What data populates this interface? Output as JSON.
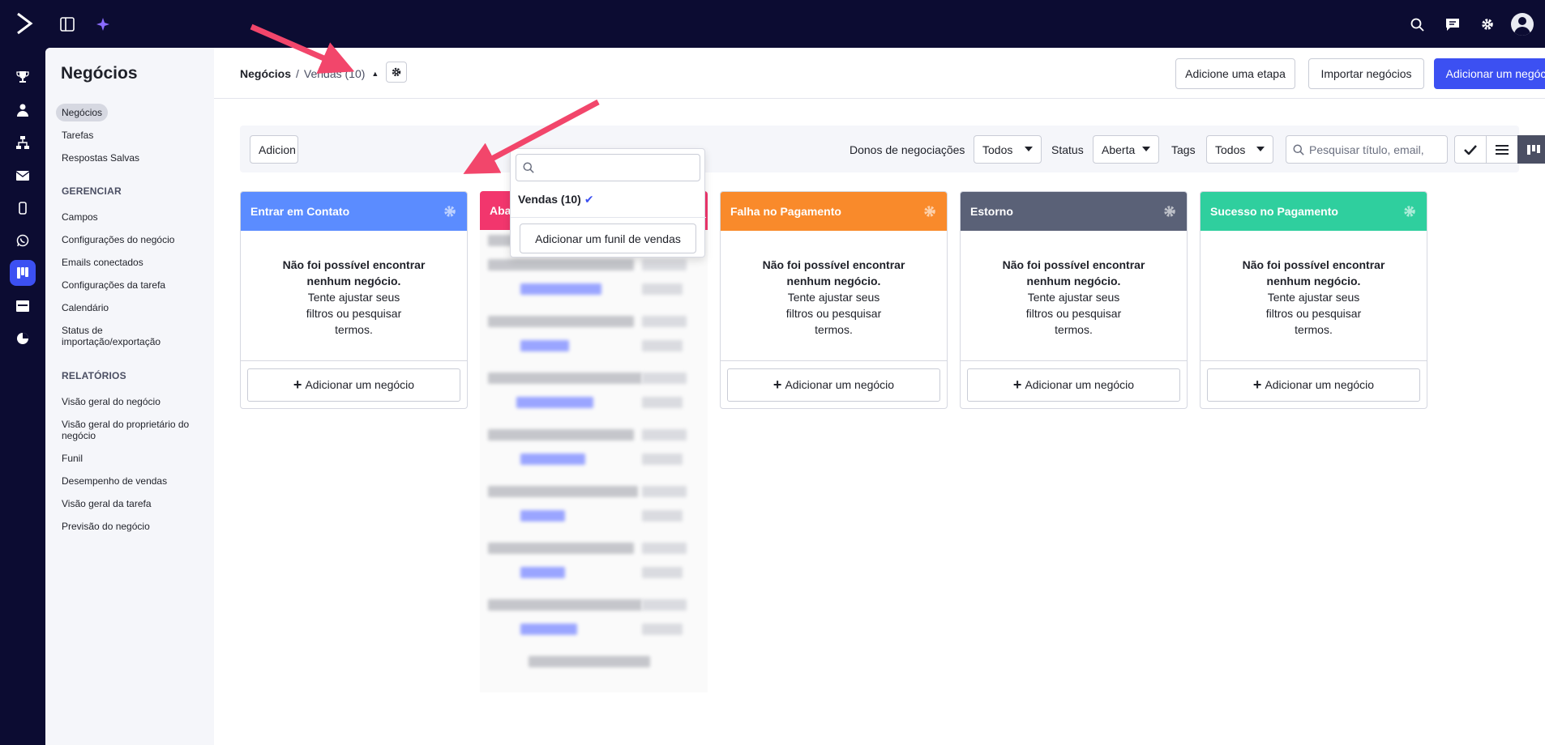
{
  "colors": {
    "brand_bg": "#0c0c32",
    "primary": "#3c50f2",
    "stage_contact": "#5b8cff",
    "stage_abandon": "#f2366d",
    "stage_payment_fail": "#f98a2b",
    "stage_chargeback": "#5a6177",
    "stage_payment_success": "#2fcf9e",
    "annotation_arrow": "#f2466b"
  },
  "subnav": {
    "title": "Negócios",
    "items": [
      {
        "label": "Negócios",
        "active": true
      },
      {
        "label": "Tarefas"
      },
      {
        "label": "Respostas Salvas"
      }
    ],
    "manage_heading": "GERENCIAR",
    "manage_items": [
      {
        "label": "Campos"
      },
      {
        "label": "Configurações do negócio"
      },
      {
        "label": "Emails conectados"
      },
      {
        "label": "Configurações da tarefa"
      },
      {
        "label": "Calendário"
      },
      {
        "label": "Status de importação/exportação"
      }
    ],
    "reports_heading": "RELATÓRIOS",
    "reports_items": [
      {
        "label": "Visão geral do negócio"
      },
      {
        "label": "Visão geral do proprietário do negócio"
      },
      {
        "label": "Funil"
      },
      {
        "label": "Desempenho de vendas"
      },
      {
        "label": "Visão geral da tarefa"
      },
      {
        "label": "Previsão do negócio"
      }
    ]
  },
  "header": {
    "breadcrumb_root": "Negócios",
    "breadcrumb_sep": "/",
    "breadcrumb_current": "Vendas (10)",
    "add_stage": "Adicione uma etapa",
    "import_deals": "Importar negócios",
    "add_deal": "Adicionar um negócio"
  },
  "filters": {
    "add_partial": "Adicion",
    "owners_label": "Donos de negociações",
    "owners_value": "Todos",
    "status_label": "Status",
    "status_value": "Aberta",
    "tags_label": "Tags",
    "tags_value": "Todos",
    "search_placeholder": "Pesquisar título, email,"
  },
  "dropdown": {
    "search_value": "",
    "pipeline": "Vendas (10)",
    "add_pipeline": "Adicionar um funil de vendas"
  },
  "empty": {
    "title": "Não foi possível encontrar nenhum negócio.",
    "hint": "Tente ajustar seus filtros ou pesquisar termos."
  },
  "columns": [
    {
      "title": "Entrar em Contato",
      "add": "Adicionar um negócio"
    },
    {
      "title": "Abandono"
    },
    {
      "title": "Falha no Pagamento",
      "add": "Adicionar um negócio"
    },
    {
      "title": "Estorno",
      "add": "Adicionar um negócio"
    },
    {
      "title": "Sucesso no Pagamento",
      "add": "Adicionar um negócio"
    }
  ]
}
